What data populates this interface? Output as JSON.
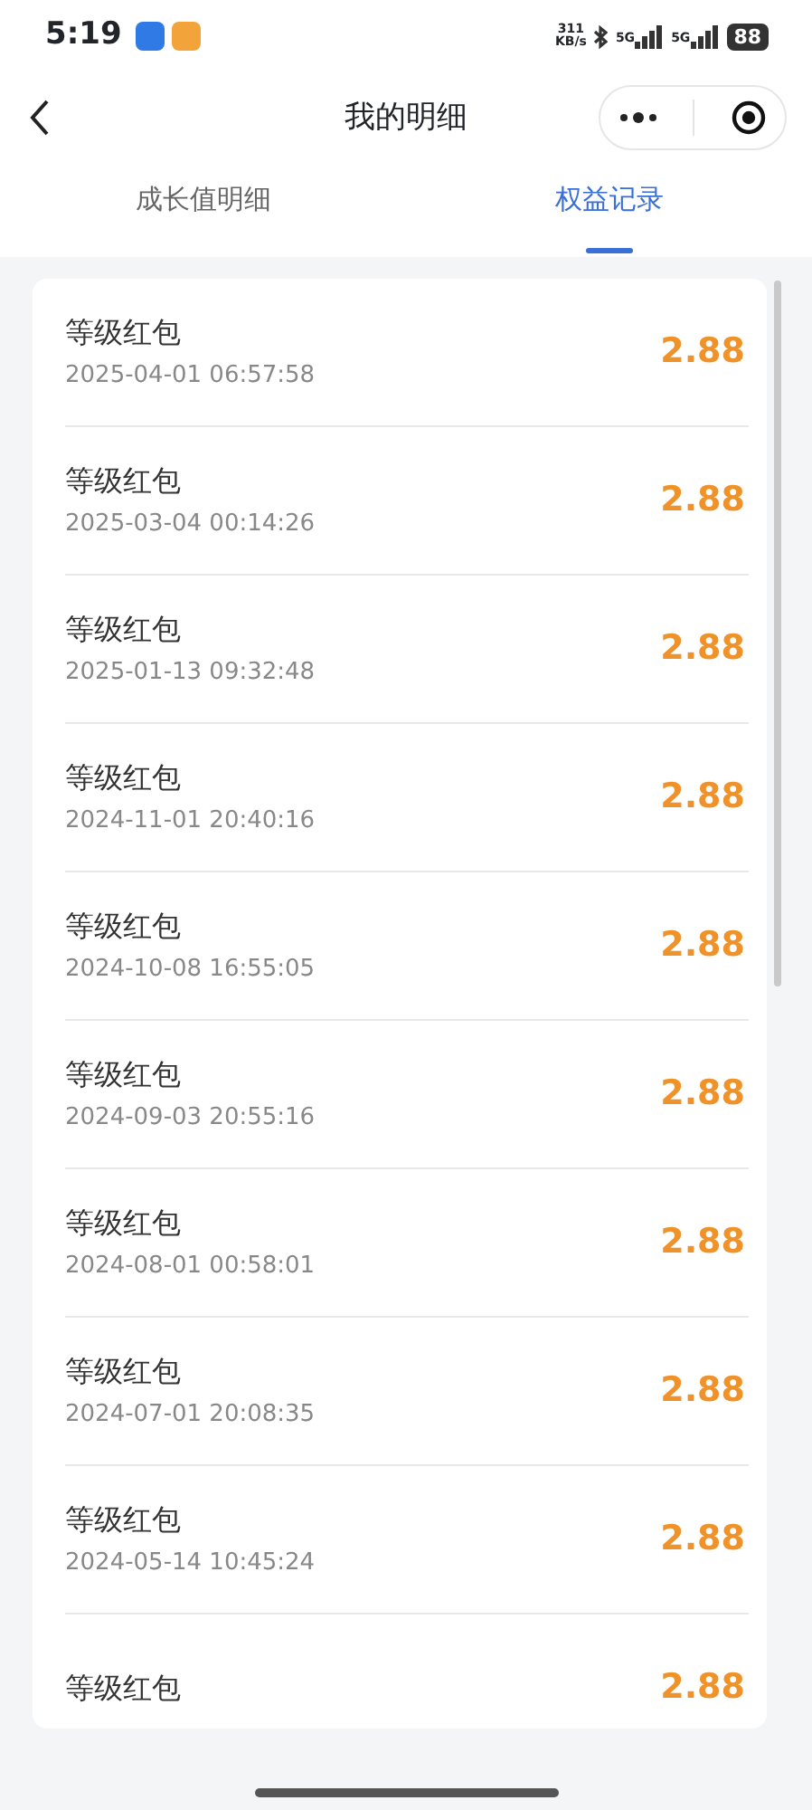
{
  "status_bar": {
    "time": "5:19",
    "net_speed_value": "311",
    "net_speed_unit": "KB/s",
    "signal_1": "5G",
    "signal_2": "5G",
    "battery": "88"
  },
  "header": {
    "title": "我的明细"
  },
  "tabs": [
    {
      "label": "成长值明细",
      "selected": false
    },
    {
      "label": "权益记录",
      "selected": true
    }
  ],
  "records": [
    {
      "title": "等级红包",
      "time": "2025-04-01 06:57:58",
      "amount": "2.88"
    },
    {
      "title": "等级红包",
      "time": "2025-03-04 00:14:26",
      "amount": "2.88"
    },
    {
      "title": "等级红包",
      "time": "2025-01-13 09:32:48",
      "amount": "2.88"
    },
    {
      "title": "等级红包",
      "time": "2024-11-01 20:40:16",
      "amount": "2.88"
    },
    {
      "title": "等级红包",
      "time": "2024-10-08 16:55:05",
      "amount": "2.88"
    },
    {
      "title": "等级红包",
      "time": "2024-09-03 20:55:16",
      "amount": "2.88"
    },
    {
      "title": "等级红包",
      "time": "2024-08-01 00:58:01",
      "amount": "2.88"
    },
    {
      "title": "等级红包",
      "time": "2024-07-01 20:08:35",
      "amount": "2.88"
    },
    {
      "title": "等级红包",
      "time": "2024-05-14 10:45:24",
      "amount": "2.88"
    },
    {
      "title": "等级红包",
      "amount": "2.88"
    }
  ]
}
